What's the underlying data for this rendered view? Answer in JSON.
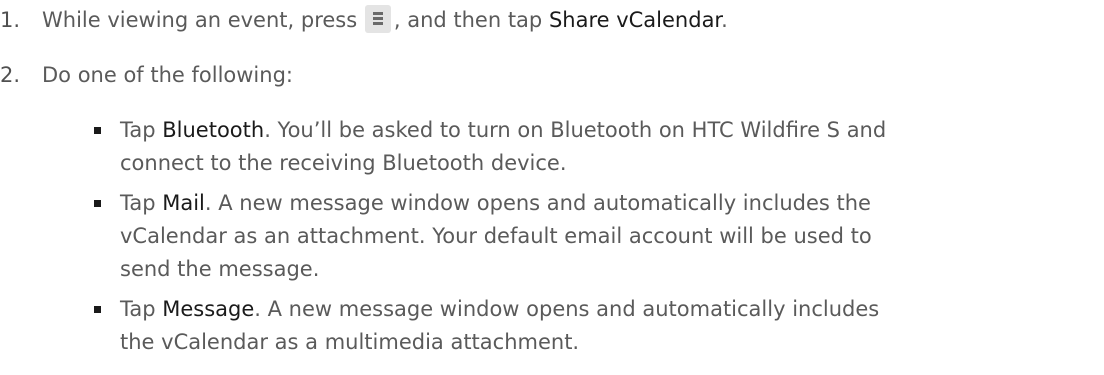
{
  "steps": [
    {
      "number": "1.",
      "parts": {
        "a": "While viewing an event, press ",
        "b": ", and then tap ",
        "c": "Share vCalendar",
        "d": "."
      },
      "icon": "menu-icon"
    },
    {
      "number": "2.",
      "text": "Do one of the following:"
    }
  ],
  "bullets": [
    {
      "prefix": "Tap ",
      "emph": "Bluetooth",
      "line1_rest": ". You’ll be asked to turn on Bluetooth on HTC Wildfire S and",
      "lines": [
        "connect to the receiving Bluetooth device."
      ]
    },
    {
      "prefix": "Tap ",
      "emph": "Mail",
      "line1_rest": ". A new message window opens and automatically includes the",
      "lines": [
        "vCalendar as an attachment. Your default email account will be used to",
        "send the message."
      ]
    },
    {
      "prefix": "Tap ",
      "emph": "Message",
      "line1_rest": ". A new message window opens and automatically includes",
      "lines": [
        "the vCalendar as a multimedia attachment."
      ]
    }
  ]
}
